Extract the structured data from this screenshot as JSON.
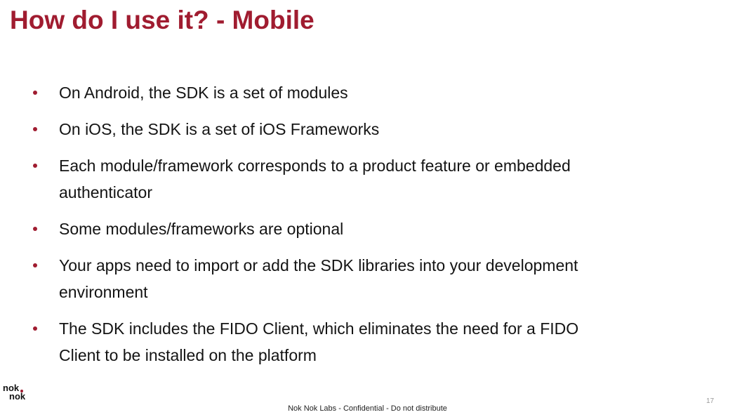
{
  "slide": {
    "title": "How do I use it? - Mobile",
    "bullets": [
      "On Android, the SDK is a set of modules",
      "On iOS, the SDK is a set of iOS Frameworks",
      "Each module/framework corresponds to a product feature or embedded authenticator",
      "Some modules/frameworks are optional",
      "Your apps need to import or add the SDK libraries into your development environment",
      "The SDK includes the FIDO Client, which eliminates the need for a FIDO Client to be installed on the platform"
    ],
    "footer": "Nok Nok Labs - Confidential - Do not distribute",
    "page_number": "17"
  },
  "logo": {
    "line1": "nok",
    "line2": "nok",
    "icon": "nok-nok-logo-icon",
    "text_color": "#111111",
    "accent_color": "#a01c30"
  },
  "colors": {
    "title": "#a01c30",
    "bullet": "#a01c30",
    "body_text": "#141414",
    "page_number": "#999999"
  }
}
